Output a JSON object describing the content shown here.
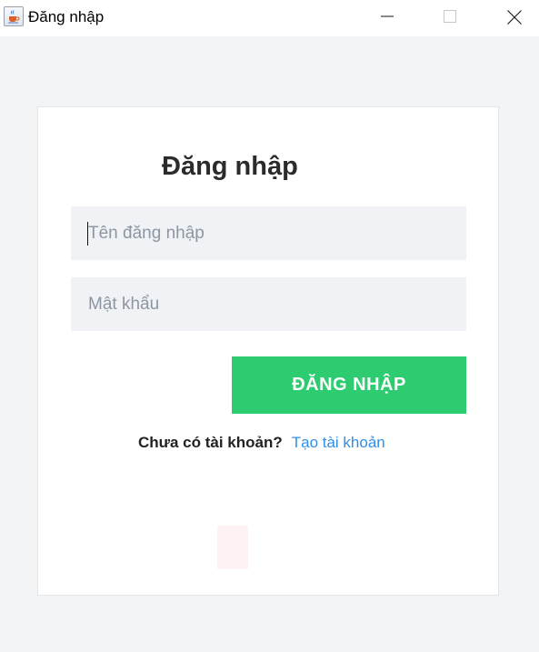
{
  "window": {
    "title": "Đăng nhập",
    "icon": "java-cup-icon",
    "controls": [
      "minimize-icon",
      "maximize-icon",
      "close-icon"
    ]
  },
  "form": {
    "heading": "Đăng nhập",
    "username_placeholder": "Tên đăng nhập",
    "username_value": "",
    "password_placeholder": "Mật khẩu",
    "password_value": "",
    "login_label": "ĐĂNG NHẬP",
    "signup_prompt": "Chưa có tài khoản?",
    "signup_link": "Tạo tài khoản"
  },
  "colors": {
    "accent": "#2ecc71",
    "link": "#2f8fe8",
    "field_bg": "#f0f2f5",
    "page_bg": "#f3f4f6"
  }
}
